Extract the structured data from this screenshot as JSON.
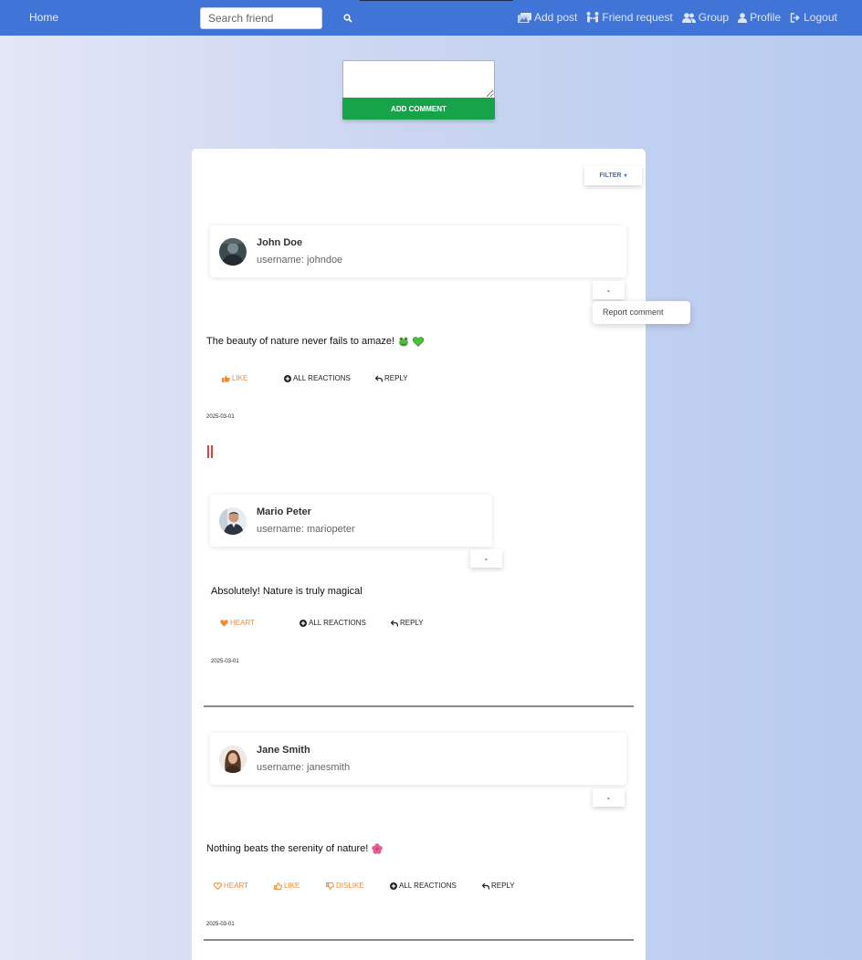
{
  "nav": {
    "home": "Home",
    "search_placeholder": "Search friend",
    "links": {
      "add_post": "Add post",
      "friend_request": "Friend request",
      "group": "Group",
      "profile": "Profile",
      "logout": "Logout"
    }
  },
  "composer": {
    "add_comment": "ADD COMMENT"
  },
  "filter": {
    "label": "FILTER"
  },
  "comments": [
    {
      "name": "John Doe",
      "username": "username: johndoe",
      "menu_toggle": "-",
      "report": "Report comment",
      "text": "The beauty of nature never fails to amaze!",
      "actions": {
        "like": "LIKE",
        "all": "ALL REACTIONS",
        "reply": "REPLY"
      },
      "date": "2025-03-01"
    },
    {
      "name": "Mario Peter",
      "username": "username: mariopeter",
      "menu_toggle": "-",
      "text": "Absolutely! Nature is truly magical",
      "actions": {
        "heart": "HEART",
        "all": "ALL REACTIONS",
        "reply": "REPLY"
      },
      "date": "2025-03-01"
    },
    {
      "name": "Jane Smith",
      "username": "username: janesmith",
      "menu_toggle": "-",
      "text": "Nothing beats the serenity of nature!",
      "actions": {
        "heart": "HEART",
        "like": "LIKE",
        "dislike": "DISLIKE",
        "all": "ALL REACTIONS",
        "reply": "REPLY"
      },
      "date": "2025-03-01"
    }
  ],
  "colors": {
    "navbar": "#4074d6",
    "accent_green": "#16a34a",
    "reaction_orange": "#f28a37",
    "reply_marker": "#e23e3e"
  }
}
